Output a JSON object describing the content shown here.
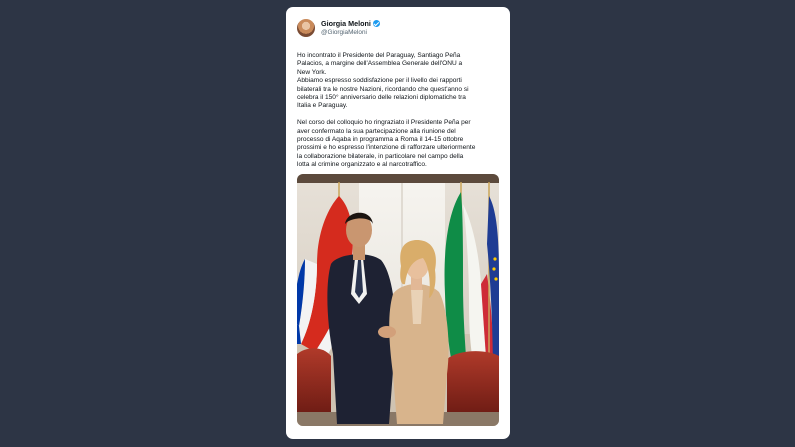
{
  "tweet": {
    "author": {
      "name": "Giorgia Meloni",
      "handle": "@GiorgiaMeloni",
      "avatar_icon": "profile-photo",
      "verified_icon": "verified-badge-icon"
    },
    "text_block_1": [
      "Ho incontrato il Presidente del Paraguay, Santiago Peña",
      "Palacios, a margine dell'Assemblea Generale dell'ONU a",
      "New York.",
      "Abbiamo espresso soddisfazione per il livello dei rapporti",
      "bilaterali tra le nostre Nazioni, ricordando che quest'anno si",
      "celebra il 150° anniversario delle relazioni diplomatiche tra",
      "Italia e Paraguay."
    ],
    "text_block_2": [
      "Nel corso del colloquio ho ringraziato il Presidente Peña per",
      "aver confermato la sua partecipazione alla riunione del",
      "processo di Aqaba in programma a Roma il 14-15 ottobre",
      "prossimi e ho espresso l'intenzione di rafforzare ulteriormente",
      "la collaborazione bilaterale, in particolare nel campo della",
      "lotta al crimine organizzato e al narcotraffico."
    ],
    "photo": {
      "flags": [
        "Paraguay",
        "Italia",
        "Unione Europea"
      ]
    }
  },
  "colors": {
    "page_background": "#2d3545",
    "card_background": "#ffffff",
    "verified_blue": "#1d9bf0",
    "text_primary": "#0f1419",
    "text_secondary": "#536471"
  }
}
